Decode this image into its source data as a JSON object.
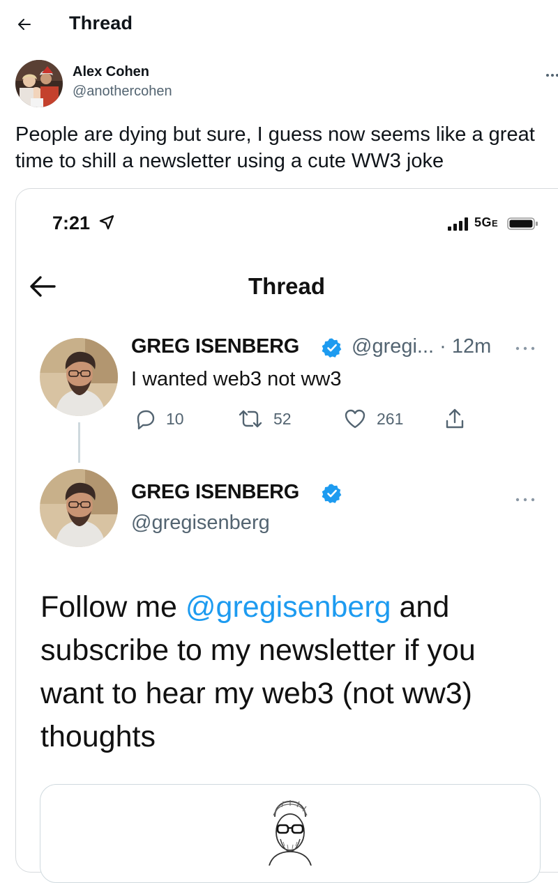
{
  "header": {
    "title": "Thread",
    "back_icon": "arrow-left-icon"
  },
  "author": {
    "name": "Alex Cohen",
    "handle": "@anothercohen",
    "more_icon": "more-horizontal-icon"
  },
  "tweet": {
    "text": "People are dying but sure, I guess now seems like a great time to shill a newsletter using a cute WW3 joke"
  },
  "screenshot": {
    "status_bar": {
      "time": "7:21",
      "network": "5G",
      "network_suffix": "E"
    },
    "header": {
      "title": "Thread"
    },
    "tweet1": {
      "name": "GREG ISENBERG",
      "meta": "@gregi... · 12m",
      "text": "I wanted web3 not ww3",
      "replies": "10",
      "retweets": "52",
      "likes": "261"
    },
    "tweet2": {
      "name": "GREG ISENBERG",
      "handle": "@gregisenberg",
      "body_prefix": "Follow me ",
      "mention": "@gregisenberg",
      "body_suffix": " and subscribe to my newsletter if you want to hear my web3 (not ww3) thoughts"
    }
  },
  "colors": {
    "link": "#1d9bf0",
    "secondary_text": "#536471",
    "verified": "#1d9bf0"
  }
}
